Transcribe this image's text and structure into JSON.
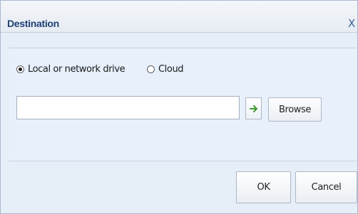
{
  "dialog": {
    "title": "Destination",
    "close_label": "X"
  },
  "source_options": [
    {
      "label": "Local or network drive",
      "selected": true
    },
    {
      "label": "Cloud",
      "selected": false
    }
  ],
  "path": {
    "value": "",
    "placeholder": ""
  },
  "buttons": {
    "go_icon": "arrow-right-icon",
    "browse_label": "Browse",
    "ok_label": "OK",
    "cancel_label": "Cancel"
  },
  "colors": {
    "title_text": "#1f3f76",
    "arrow": "#3c9a2e",
    "panel_bg": "#e7f0fb"
  }
}
